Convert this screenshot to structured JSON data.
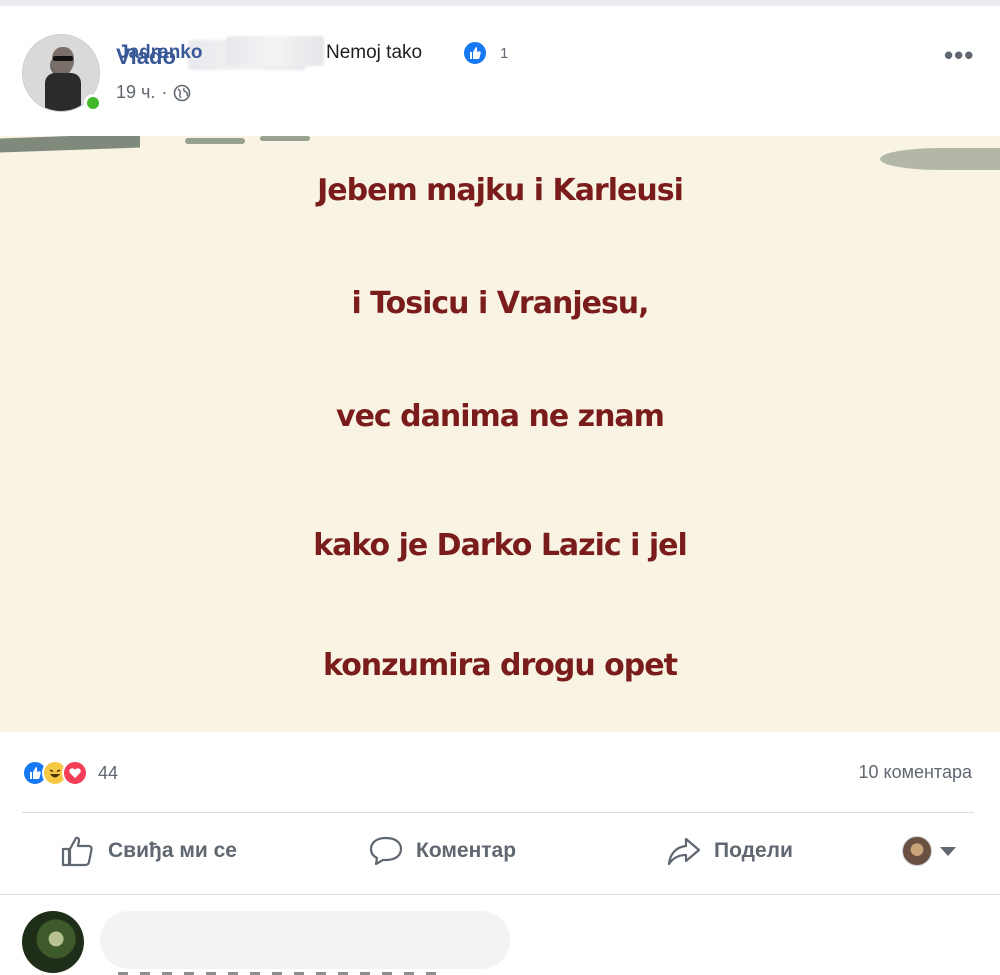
{
  "post": {
    "author_first_name": "Vlado",
    "time": "19 ч.",
    "separator": "·",
    "privacy_icon": "globe-icon",
    "more_icon": "more-options-icon"
  },
  "image": {
    "lines": [
      "Jebem majku i Karleusi",
      "i Tosicu i Vranjesu,",
      "vec danima ne znam",
      "kako je Darko Lazic i jel",
      "konzumira drogu opet"
    ],
    "text_color": "#7a1c1c",
    "background_color": "#f8f3e3"
  },
  "reactions": {
    "icons": [
      "like-icon",
      "haha-icon",
      "love-icon"
    ],
    "count": "44",
    "comments": "10 коментара"
  },
  "actions": {
    "like": "Свиђа ми се",
    "comment": "Коментар",
    "share": "Подели"
  },
  "comment": {
    "author_first_name": "Jadranko",
    "text": "Nemoj tako",
    "reaction_count": "1"
  },
  "colors": {
    "link_blue": "#385898",
    "like_blue": "#1877f2",
    "love_red": "#f33e58",
    "haha_yellow": "#f7c844",
    "online_green": "#42b72a"
  }
}
